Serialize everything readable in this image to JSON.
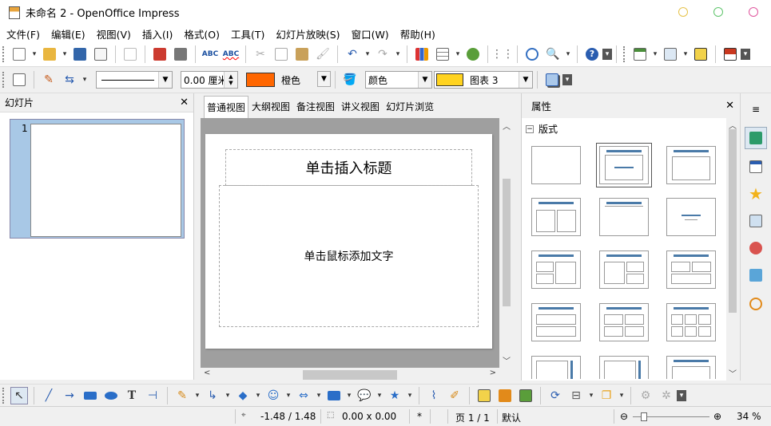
{
  "window": {
    "title": "未命名 2 - OpenOffice Impress",
    "dot_colors": [
      "#e6c34a",
      "#5ec46b",
      "#e0569e"
    ]
  },
  "menu": [
    "文件(F)",
    "编辑(E)",
    "视图(V)",
    "插入(I)",
    "格式(O)",
    "工具(T)",
    "幻灯片放映(S)",
    "窗口(W)",
    "帮助(H)"
  ],
  "format_bar": {
    "line_width": "0.00 厘米",
    "line_color_label": "橙色",
    "line_color": "#ff6600",
    "area_style": "颜色",
    "area_color_label": "图表 3",
    "area_color": "#ffd320"
  },
  "slides_panel": {
    "title": "幻灯片",
    "slide_number": "1"
  },
  "view_tabs": [
    "普通视图",
    "大纲视图",
    "备注视图",
    "讲义视图",
    "幻灯片浏览"
  ],
  "slide": {
    "title_placeholder": "单击插入标题",
    "body_placeholder": "单击鼠标添加文字"
  },
  "properties": {
    "title": "属性",
    "section": "版式"
  },
  "status": {
    "position": "-1.48 / 1.48",
    "size": "0.00 x 0.00",
    "modified": "*",
    "page": "页 1 / 1",
    "master": "默认",
    "zoom": "34 %"
  }
}
